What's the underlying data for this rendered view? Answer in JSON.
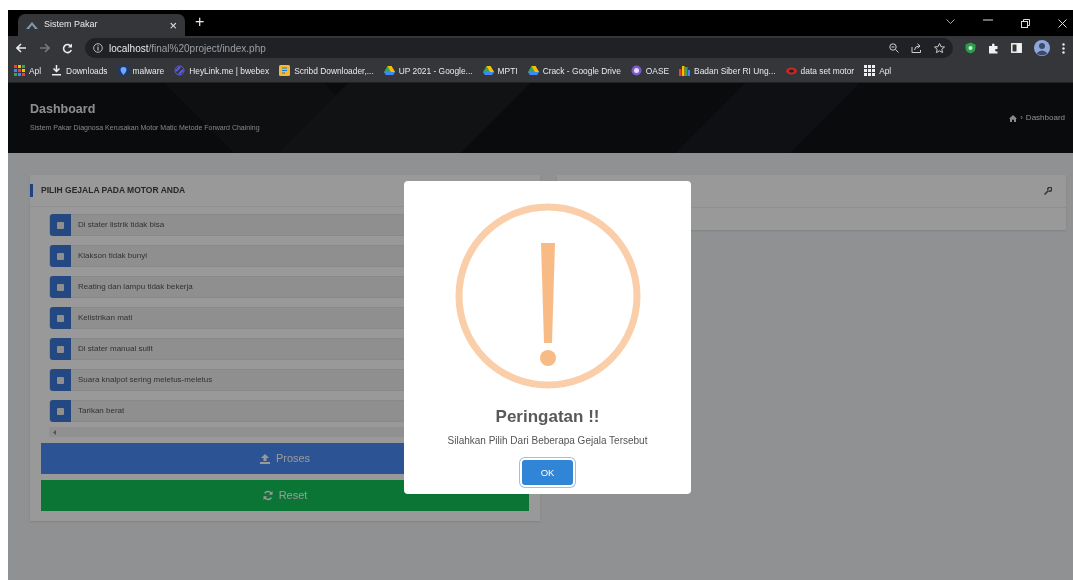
{
  "browser": {
    "tab": {
      "title": "Sistem Pakar",
      "close": "×"
    },
    "new_tab": "+",
    "address": {
      "host": "localhost",
      "path": "/final%20project/index.php"
    },
    "bookmarks": [
      {
        "label": "Apl",
        "kind": "apps"
      },
      {
        "label": "Downloads",
        "kind": "download"
      },
      {
        "label": "malware",
        "kind": "shield"
      },
      {
        "label": "HeyLink.me | bwebex",
        "kind": "link"
      },
      {
        "label": "Scribd Downloader,...",
        "kind": "doc"
      },
      {
        "label": "UP 2021 - Google...",
        "kind": "drive"
      },
      {
        "label": "MPTI",
        "kind": "drive"
      },
      {
        "label": "Crack - Google Drive",
        "kind": "drive"
      },
      {
        "label": "OASE",
        "kind": "badge"
      },
      {
        "label": "Badan Siber RI Ung...",
        "kind": "bars"
      },
      {
        "label": "data set motor",
        "kind": "moto"
      },
      {
        "label": "Apl",
        "kind": "grid"
      }
    ]
  },
  "header": {
    "title": "Dashboard",
    "subtitle": "Sistem Pakar Diagnosa Kerusakan Motor Matic Metode Forward Chaining",
    "breadcrumb": {
      "separator": "›",
      "current": "Dashboard"
    }
  },
  "symptoms_card": {
    "title": "PILIH GEJALA PADA MOTOR ANDA",
    "symptoms": [
      {
        "label": "Di stater listrik tidak bisa",
        "checked": false
      },
      {
        "label": "Klakson tidak bunyi",
        "checked": false
      },
      {
        "label": "Reating dan lampu tidak bekerja",
        "checked": false
      },
      {
        "label": "Kelistrikan mati",
        "checked": false
      },
      {
        "label": "Di stater manual sulit",
        "checked": false
      },
      {
        "label": "Suara knalpot sering meletus-meletus",
        "checked": false
      },
      {
        "label": "Tarikan berat",
        "checked": false
      }
    ],
    "buttons": [
      {
        "label": "Proses",
        "kind": "process"
      },
      {
        "label": "Reset",
        "kind": "reset"
      }
    ]
  },
  "alert": {
    "title": "Peringatan !!",
    "message": "Silahkan Pilih Dari Beberapa Gejala Tersebut",
    "button": "OK"
  }
}
